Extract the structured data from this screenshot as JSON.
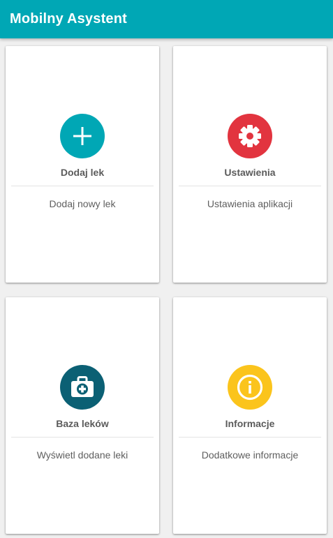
{
  "app_bar": {
    "title": "Mobilny Asystent",
    "color": "#00a7b5"
  },
  "cards": [
    {
      "title": "Dodaj lek",
      "description": "Dodaj nowy lek",
      "icon": "plus-icon",
      "icon_color": "#00a7b5"
    },
    {
      "title": "Ustawienia",
      "description": "Ustawienia aplikacji",
      "icon": "gear-icon",
      "icon_color": "#e2343f"
    },
    {
      "title": "Baza leków",
      "description": "Wyświetl dodane leki",
      "icon": "medical-kit-icon",
      "icon_color": "#0b6074"
    },
    {
      "title": "Informacje",
      "description": "Dodatkowe informacje",
      "icon": "info-icon",
      "icon_color": "#fbc41c"
    }
  ]
}
